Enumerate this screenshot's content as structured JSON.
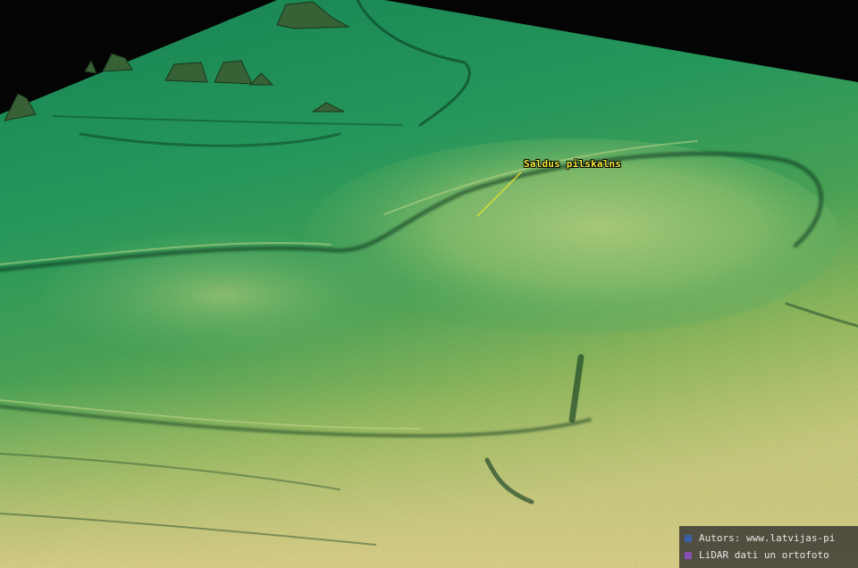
{
  "map": {
    "place_label": "Saldus pilskalns"
  },
  "credits": {
    "items": [
      {
        "text": "Autors: www.latvijas-pi",
        "color": "#3a5fa8"
      },
      {
        "text": "LiDAR dati un ortofoto",
        "color": "#8a4fb3"
      }
    ]
  },
  "colors": {
    "low_terrain": "#1f9a62",
    "mid_terrain": "#6fbf5a",
    "high_terrain": "#e7dc8a",
    "label_text": "#f4ea3a",
    "leader_line": "#e8d93a",
    "sky": "#050505"
  }
}
